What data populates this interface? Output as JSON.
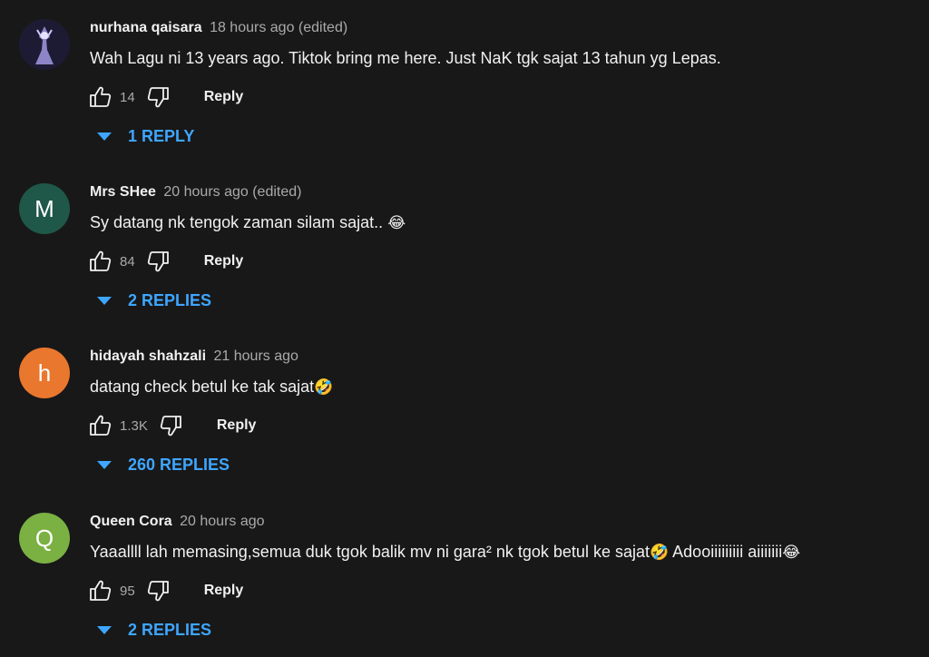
{
  "comments": [
    {
      "author": "nurhana qaisara",
      "meta": "18 hours ago (edited)",
      "text": "Wah Lagu ni 13 years ago. Tiktok bring me here. Just NaK tgk sajat 13 tahun yg Lepas.",
      "likes": "14",
      "reply_label": "Reply",
      "replies_label": "1 REPLY",
      "avatar_letter": "",
      "avatar_color": "#2a2448"
    },
    {
      "author": "Mrs SHee",
      "meta": "20 hours ago (edited)",
      "text": "Sy datang nk tengok zaman silam sajat.. ",
      "emoji": "😂",
      "likes": "84",
      "reply_label": "Reply",
      "replies_label": "2 REPLIES",
      "avatar_letter": "M",
      "avatar_color": "#1f5748"
    },
    {
      "author": "hidayah shahzali",
      "meta": "21 hours ago",
      "text": "datang check betul ke tak sajat",
      "emoji": "🤣",
      "likes": "1.3K",
      "reply_label": "Reply",
      "replies_label": "260 REPLIES",
      "avatar_letter": "h",
      "avatar_color": "#e9772e"
    },
    {
      "author": "Queen Cora",
      "meta": "20 hours ago",
      "text": "Yaaallll lah memasing,semua duk tgok balik mv ni gara² nk tgok betul ke sajat",
      "emoji": "🤣",
      "text2": " Adooiiiiiiiii aiiiiiii",
      "emoji2": "😂",
      "likes": "95",
      "reply_label": "Reply",
      "replies_label": "2 REPLIES",
      "avatar_letter": "Q",
      "avatar_color": "#7bb043"
    }
  ],
  "icons": {
    "like": "thumbs-up-icon",
    "dislike": "thumbs-down-icon",
    "expand": "caret-down-icon"
  },
  "colors": {
    "background": "#181818",
    "link": "#3ea6ff",
    "secondary_text": "#aaaaaa"
  }
}
